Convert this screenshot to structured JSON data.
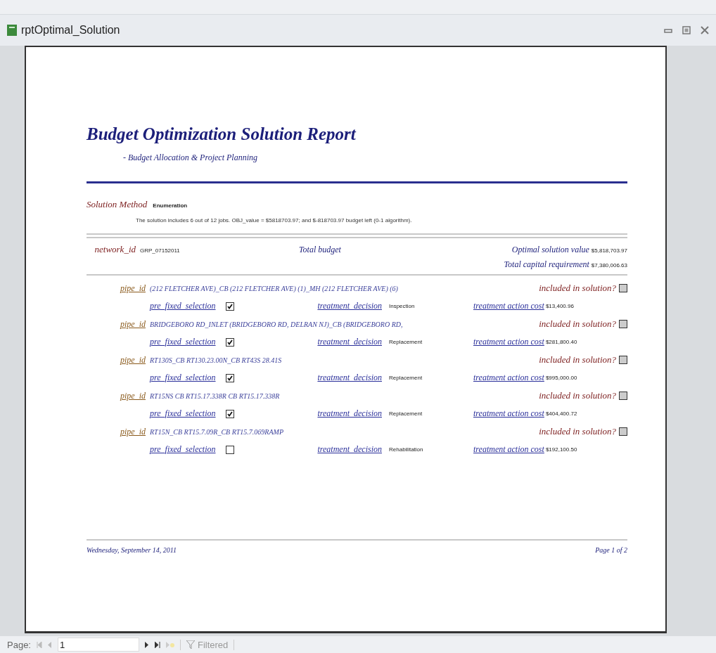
{
  "window": {
    "title": "rptOptimal_Solution"
  },
  "report": {
    "title": "Budget Optimization Solution Report",
    "subtitle": "- Budget Allocation & Project Planning",
    "method_label": "Solution Method",
    "method_value": "Enumeration",
    "summary": "The solution includes 6 out of 12 jobs.  OBJ_value = $5818703.97; and $-818703.97 budget left (0-1 algorithm).",
    "network_label": "network_id",
    "network_value": "GRP_07152011",
    "budget_label": "Total budget",
    "optimal_label": "Optimal solution value",
    "optimal_value": "$5,818,703.97",
    "capital_label": "Total capital requirement",
    "capital_value": "$7,380,006.63",
    "pipes": [
      {
        "id_label": "pipe_id",
        "id": "(212 FLETCHER AVE)_CB (212 FLETCHER AVE) (1)_MH (212 FLETCHER AVE) (6)",
        "included_label": "included in solution?",
        "included": false,
        "prefixed_label": "pre_fixed_selection",
        "prefixed": true,
        "decision_label": "treatment_decision",
        "decision": "Inspection",
        "cost_label": "treatment action cost",
        "cost": "$13,400.96"
      },
      {
        "id_label": "pipe_id",
        "id": "BRIDGEBORO RD_INLET (BRIDGEBORO RD, DELRAN NJ)_CB (BRIDGEBORO RD,",
        "included_label": "included in solution?",
        "included": false,
        "prefixed_label": "pre_fixed_selection",
        "prefixed": true,
        "decision_label": "treatment_decision",
        "decision": "Replacement",
        "cost_label": "treatment action cost",
        "cost": "$281,800.40"
      },
      {
        "id_label": "pipe_id",
        "id": "RT130S_CB RT130.23.00N_CB RT43S 28.41S",
        "included_label": "included in solution?",
        "included": false,
        "prefixed_label": "pre_fixed_selection",
        "prefixed": true,
        "decision_label": "treatment_decision",
        "decision": "Replacement",
        "cost_label": "treatment action cost",
        "cost": "$995,000.00"
      },
      {
        "id_label": "pipe_id",
        "id": "RT15NS CB RT15.17.338R CB RT15.17.338R",
        "included_label": "included in solution?",
        "included": false,
        "prefixed_label": "pre_fixed_selection",
        "prefixed": true,
        "decision_label": "treatment_decision",
        "decision": "Replacement",
        "cost_label": "treatment action cost",
        "cost": "$404,400.72"
      },
      {
        "id_label": "pipe_id",
        "id": "RT15N_CB RT15.7.09R_CB RT15.7.069RAMP",
        "included_label": "included in solution?",
        "included": false,
        "prefixed_label": "pre_fixed_selection",
        "prefixed": false,
        "decision_label": "treatment_decision",
        "decision": "Rehabilitation",
        "cost_label": "treatment action cost",
        "cost": "$192,100.50"
      }
    ],
    "footer_date": "Wednesday, September 14, 2011",
    "footer_page": "Page 1 of 2"
  },
  "navigation": {
    "page_label": "Page:",
    "page_value": "1",
    "filter_label": "Filtered"
  }
}
